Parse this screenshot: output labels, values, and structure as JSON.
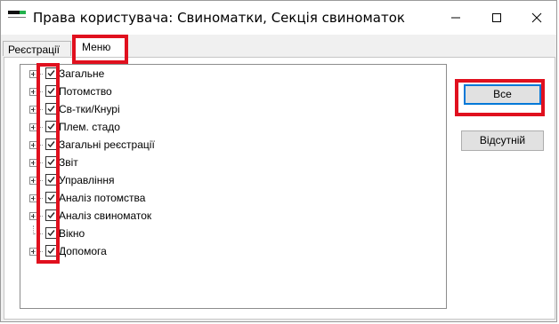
{
  "window": {
    "title": "Права користувача: Свиноматки, Секція свиноматок"
  },
  "tabs": [
    {
      "label": "Реєстрації"
    },
    {
      "label": "Меню"
    }
  ],
  "tree": {
    "items": [
      {
        "label": "Загальне",
        "checked": true,
        "expandable": true
      },
      {
        "label": "Потомство",
        "checked": true,
        "expandable": true
      },
      {
        "label": "Св-тки/Кнурі",
        "checked": true,
        "expandable": true
      },
      {
        "label": "Плем. стадо",
        "checked": true,
        "expandable": true
      },
      {
        "label": "Загальні реєстрації",
        "checked": true,
        "expandable": true
      },
      {
        "label": "Звіт",
        "checked": true,
        "expandable": true
      },
      {
        "label": "Управління",
        "checked": true,
        "expandable": true
      },
      {
        "label": "Аналіз потомства",
        "checked": true,
        "expandable": true
      },
      {
        "label": "Аналіз свиноматок",
        "checked": true,
        "expandable": true
      },
      {
        "label": "Вікно",
        "checked": true,
        "expandable": false
      },
      {
        "label": "Допомога",
        "checked": true,
        "expandable": true
      }
    ]
  },
  "buttons": {
    "all_label": "Все",
    "none_label": "Відсутній"
  },
  "colors": {
    "highlight": "#e0101e",
    "accent": "#0078d7"
  }
}
